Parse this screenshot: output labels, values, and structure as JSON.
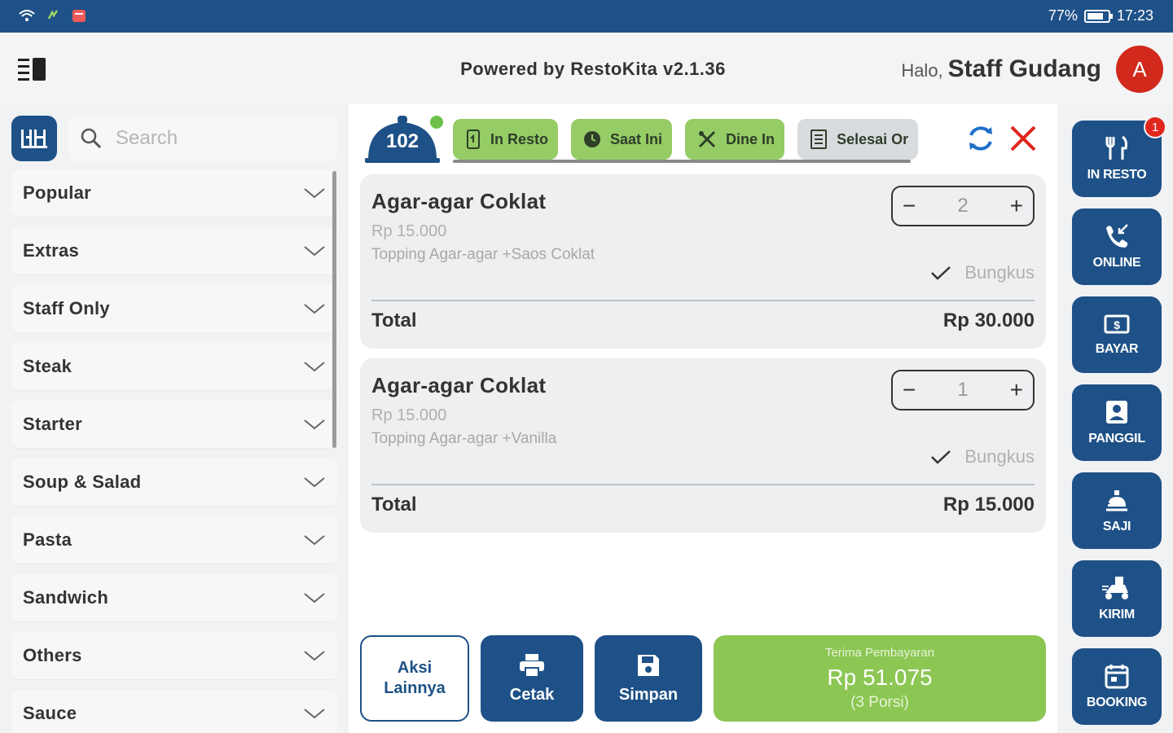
{
  "status_bar": {
    "battery": "77%",
    "time": "17:23"
  },
  "header": {
    "powered_by": "Powered by RestoKita v2.1.36",
    "greeting": "Halo,",
    "user_name": "Staff Gudang",
    "avatar_initial": "A"
  },
  "search": {
    "placeholder": "Search"
  },
  "categories": [
    "Popular",
    "Extras",
    "Staff Only",
    "Steak",
    "Starter",
    "Soup & Salad",
    "Pasta",
    "Sandwich",
    "Others",
    "Sauce"
  ],
  "order": {
    "table_number": "102",
    "chips": [
      "In Resto",
      "Saat Ini",
      "Dine In",
      "Selesai Or"
    ],
    "items": [
      {
        "name": "Agar-agar Coklat",
        "price": "Rp 15.000",
        "topping": "Topping Agar-agar +Saos Coklat",
        "qty": "2",
        "bungkus": "Bungkus",
        "total_label": "Total",
        "total": "Rp 30.000"
      },
      {
        "name": "Agar-agar Coklat",
        "price": "Rp 15.000",
        "topping": "Topping Agar-agar +Vanilla",
        "qty": "1",
        "bungkus": "Bungkus",
        "total_label": "Total",
        "total": "Rp 15.000"
      }
    ]
  },
  "actions": {
    "more_line1": "Aksi",
    "more_line2": "Lainnya",
    "print": "Cetak",
    "save": "Simpan",
    "payment_label": "Terima Pembayaran",
    "payment_amount": "Rp 51.075",
    "payment_portions": "(3 Porsi)"
  },
  "rail": {
    "notification_count": "1",
    "buttons": [
      "IN RESTO",
      "ONLINE",
      "BAYAR",
      "PANGGIL",
      "SAJI",
      "KIRIM",
      "BOOKING"
    ]
  },
  "colors": {
    "primary": "#1e5187",
    "accent_green": "#8cc653",
    "alert_red": "#e0261d"
  }
}
